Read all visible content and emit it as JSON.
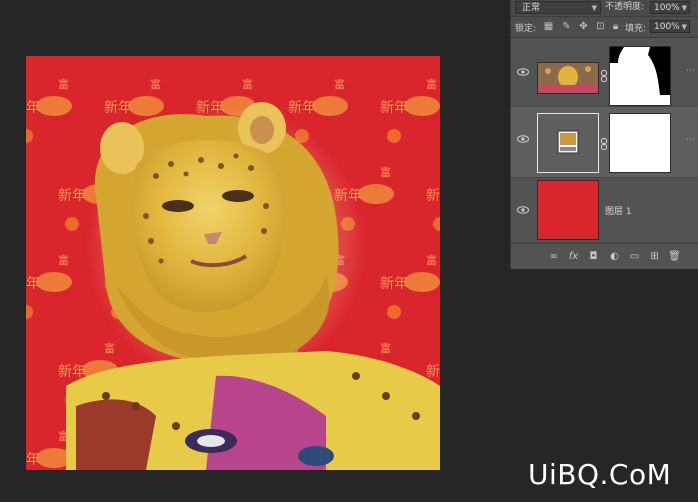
{
  "layers_panel": {
    "blend_mode": "正常",
    "opacity_label": "不透明度:",
    "opacity_value": "100%",
    "lock_label": "锁定:",
    "fill_label": "填充:",
    "fill_value": "100%",
    "layers": [
      {
        "name": "",
        "has_mask": true
      },
      {
        "name": "",
        "smart_object": true
      },
      {
        "name": "图层 1"
      }
    ],
    "footer_icons": [
      "link-layers-icon",
      "fx-icon",
      "add-mask-icon",
      "adjustment-icon",
      "group-folder-icon",
      "new-layer-icon",
      "trash-icon"
    ]
  },
  "canvas": {
    "pattern_text_a": "新年",
    "pattern_text_b": "富",
    "background_color": "#d9262d"
  },
  "watermark": "UiBQ.CoM"
}
